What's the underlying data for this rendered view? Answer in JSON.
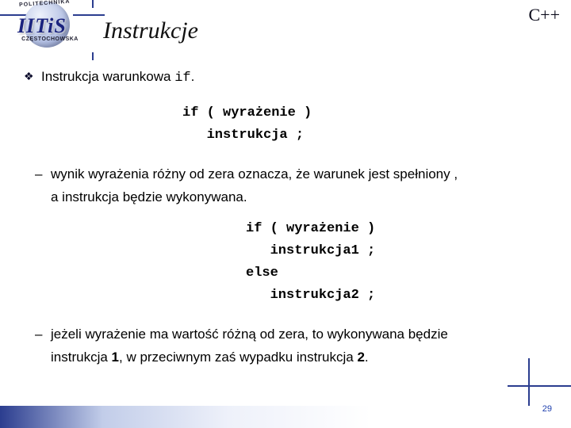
{
  "badge": "C++",
  "title": "Instrukcje",
  "logo": {
    "text": "IITiS",
    "arc_bottom": "CZĘSTOCHOWSKA",
    "arc_top": "POLITECHNIKA"
  },
  "bullet1": {
    "text_before": "Instrukcja warunkowa ",
    "code": "if",
    "text_after": "."
  },
  "code1": {
    "line1": "if ( wyrażenie )",
    "line2": "   instrukcja ;"
  },
  "para1": {
    "line1": "wynik wyrażenia różny od zera oznacza, że warunek jest spełniony ,",
    "line2": "a instrukcja będzie wykonywana."
  },
  "code2": {
    "line1": "if ( wyrażenie )",
    "line2": "   instrukcja1 ;",
    "line3": "else",
    "line4": "   instrukcja2 ;"
  },
  "para2": {
    "line1a": "jeżeli wyrażenie ma wartość różną od zera, to wykonywana będzie",
    "line2a": "instrukcja ",
    "ref1": "1",
    "mid": ",  w przeciwnym zaś wypadku instrukcja ",
    "ref2": "2",
    "end": "."
  },
  "page_number": "29"
}
